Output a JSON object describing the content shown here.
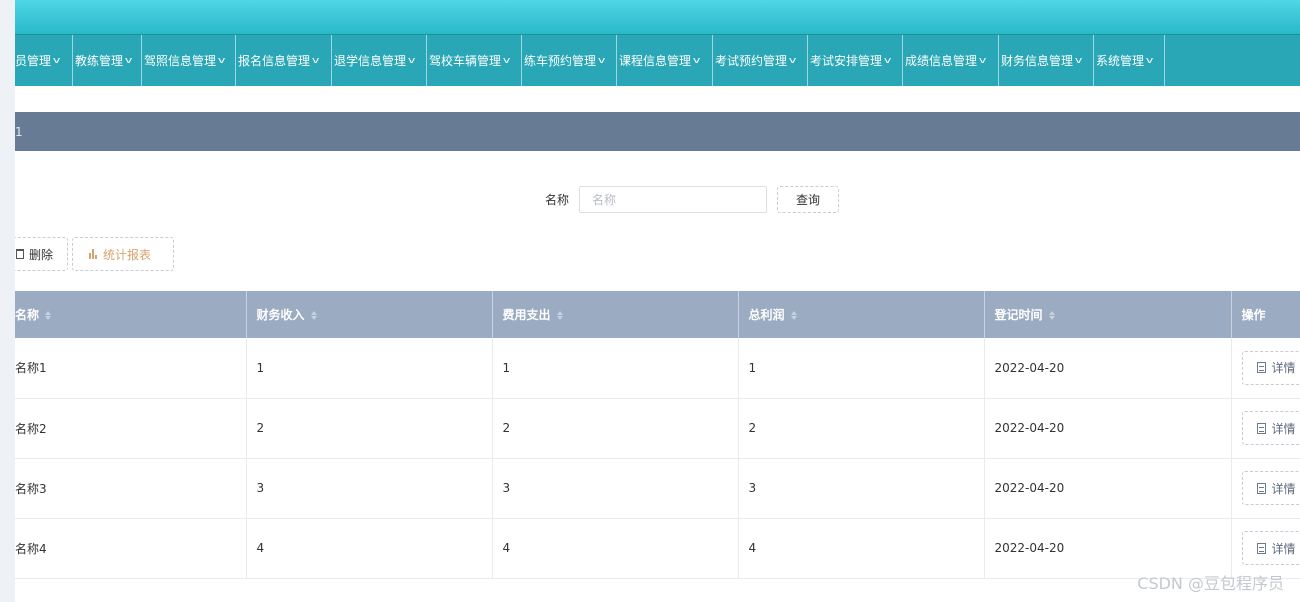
{
  "nav": {
    "items": [
      {
        "label": "员管理"
      },
      {
        "label": "教练管理"
      },
      {
        "label": "驾照信息管理"
      },
      {
        "label": "报名信息管理"
      },
      {
        "label": "退学信息管理"
      },
      {
        "label": "驾校车辆管理"
      },
      {
        "label": "练车预约管理"
      },
      {
        "label": "课程信息管理"
      },
      {
        "label": "考试预约管理"
      },
      {
        "label": "考试安排管理"
      },
      {
        "label": "成绩信息管理"
      },
      {
        "label": "财务信息管理"
      },
      {
        "label": "系统管理"
      }
    ]
  },
  "breadcrumb": {
    "text": "1"
  },
  "search": {
    "label": "名称",
    "placeholder": "名称",
    "button": "查询"
  },
  "actions": {
    "delete": "删除",
    "report": "统计报表"
  },
  "table": {
    "columns": [
      "名称",
      "财务收入",
      "费用支出",
      "总利润",
      "登记时间",
      "操作"
    ],
    "rows": [
      {
        "name": "名称1",
        "income": "1",
        "expense": "1",
        "profit": "1",
        "date": "2022-04-20",
        "action": "详情"
      },
      {
        "name": "名称2",
        "income": "2",
        "expense": "2",
        "profit": "2",
        "date": "2022-04-20",
        "action": "详情"
      },
      {
        "name": "名称3",
        "income": "3",
        "expense": "3",
        "profit": "3",
        "date": "2022-04-20",
        "action": "详情"
      },
      {
        "name": "名称4",
        "income": "4",
        "expense": "4",
        "profit": "4",
        "date": "2022-04-20",
        "action": "详情"
      }
    ]
  },
  "watermark": "CSDN @豆包程序员",
  "colors": {
    "topbar": "#29b9c9",
    "nav": "#2aa7b6",
    "breadcrumb": "#677b94",
    "table_header": "#9aabc2",
    "report_accent": "#d8a36f"
  },
  "icons": {
    "nav_dropdown": "chevron-down-icon",
    "delete": "trash-icon",
    "report": "bar-chart-icon",
    "detail": "document-icon",
    "sort": "sort-icon"
  }
}
